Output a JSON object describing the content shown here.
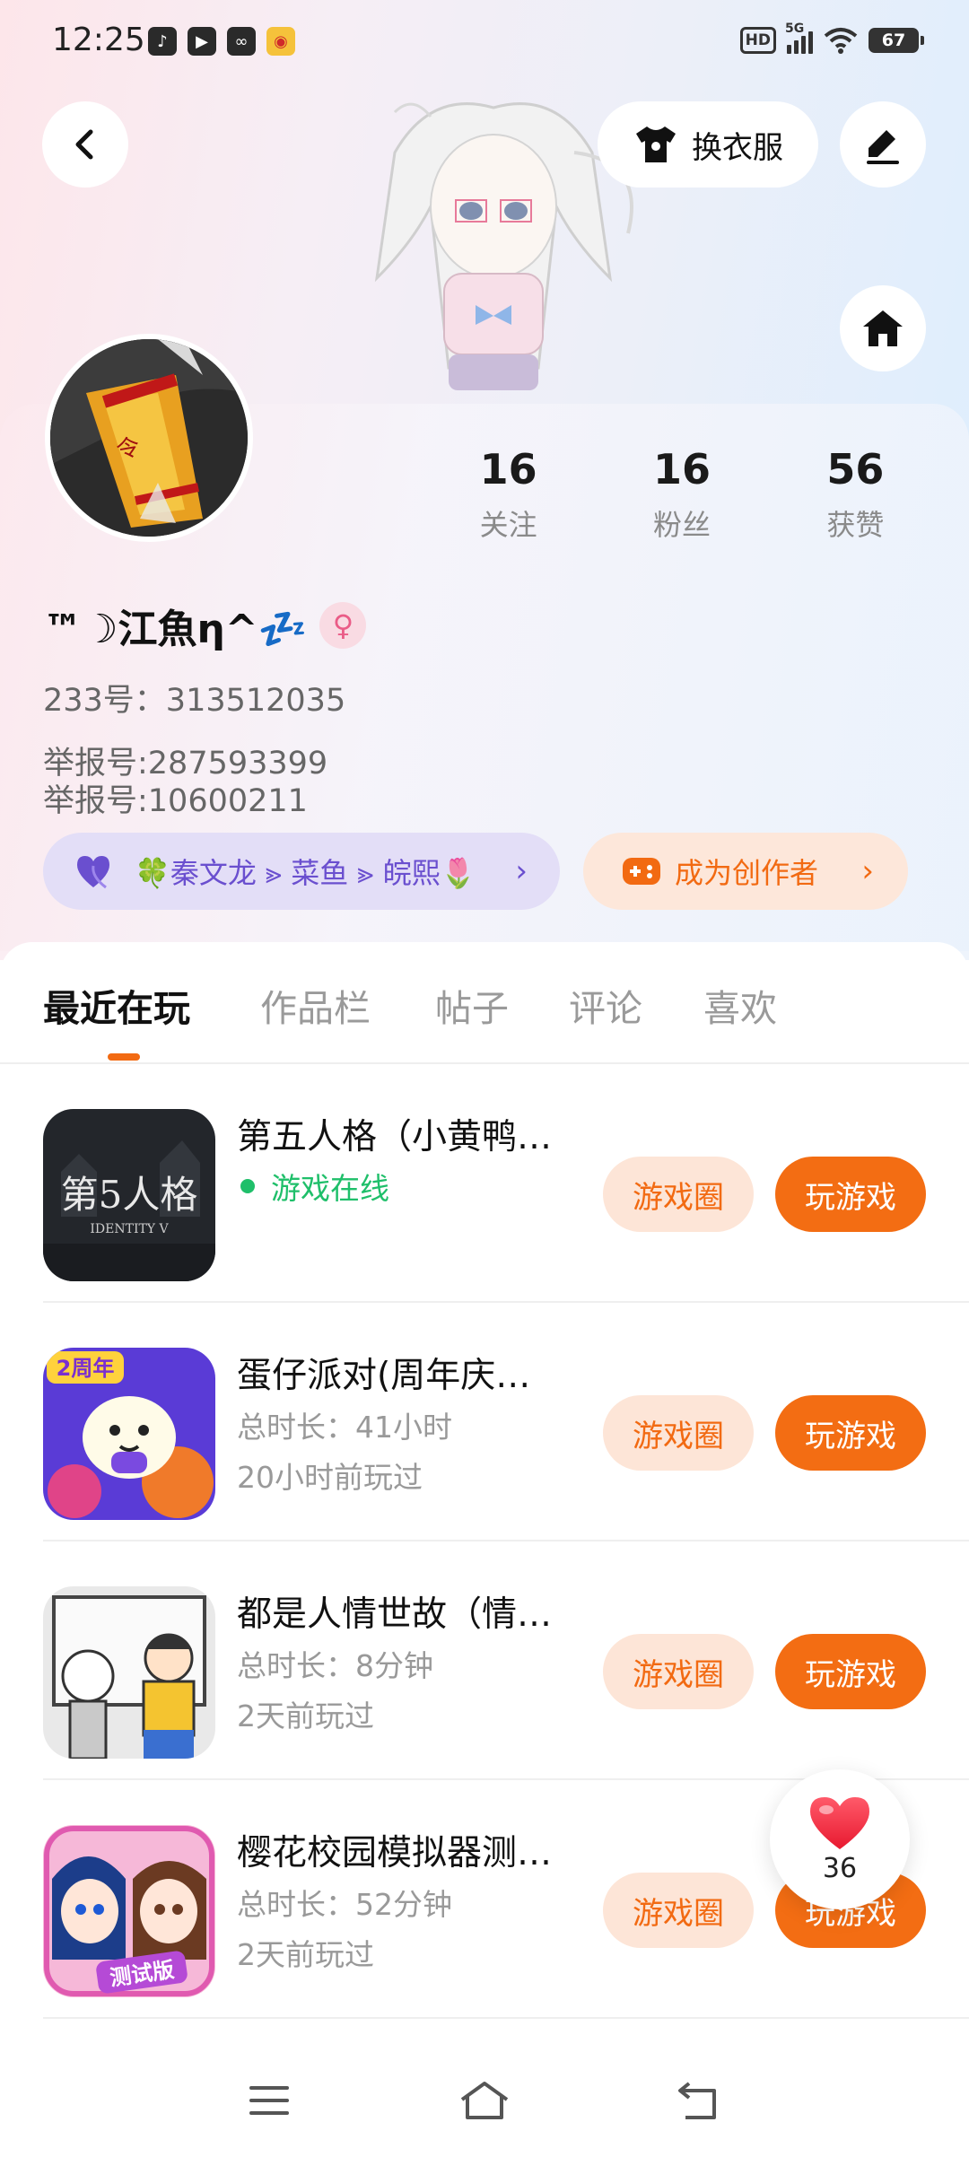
{
  "status_bar": {
    "time": "12:25",
    "app_icons": [
      "tiktok-icon",
      "play-icon",
      "link-icon",
      "weibo-icon"
    ],
    "network": "5G",
    "hd": "HD",
    "battery": "67"
  },
  "header": {
    "dress_label": "换衣服"
  },
  "profile": {
    "stats": [
      {
        "value": "16",
        "label": "关注"
      },
      {
        "value": "16",
        "label": "粉丝"
      },
      {
        "value": "56",
        "label": "获赞"
      }
    ],
    "username": "™☽江魚η^💤",
    "uid": "233号：313512035",
    "report_1": "举报号:287593399",
    "report_2": "举报号:10600211",
    "fans_pill": "🍀秦文龙 ⪢ 菜鱼 ⪢ 皖熙🌷",
    "creator_pill": "成为创作者"
  },
  "tabs": [
    "最近在玩",
    "作品栏",
    "帖子",
    "评论",
    "喜欢"
  ],
  "games": [
    {
      "title": "第五人格（小黄鸭…",
      "sub1": "游戏在线",
      "sub2": "",
      "online": true,
      "circle_label": "游戏圈",
      "play_label": "玩游戏"
    },
    {
      "title": "蛋仔派对(周年庆…",
      "sub1": "总时长：41小时",
      "sub2": "20小时前玩过",
      "online": false,
      "circle_label": "游戏圈",
      "play_label": "玩游戏"
    },
    {
      "title": "都是人情世故（情…",
      "sub1": "总时长：8分钟",
      "sub2": "2天前玩过",
      "online": false,
      "circle_label": "游戏圈",
      "play_label": "玩游戏"
    },
    {
      "title": "樱花校园模拟器测…",
      "sub1": "总时长：52分钟",
      "sub2": "2天前玩过",
      "online": false,
      "circle_label": "游戏圈",
      "play_label": "玩游戏"
    }
  ],
  "game_icon_texts": {
    "identity_v": "第5人格",
    "identity_v_sub": "IDENTITY V",
    "eggy_badge": "2周年",
    "sakura_badge": "测试版"
  },
  "like_float": {
    "count": "36"
  },
  "colors": {
    "accent": "#f36d13",
    "online": "#1fbf6a",
    "fans_purple": "#6a4fcf"
  }
}
